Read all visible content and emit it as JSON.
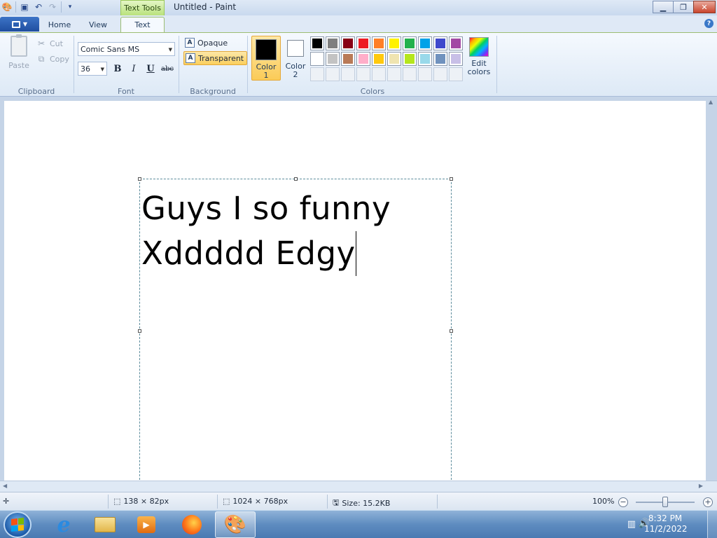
{
  "window": {
    "title": "Untitled - Paint",
    "context_tab": "Text Tools"
  },
  "tabs": [
    "Home",
    "View",
    "Text"
  ],
  "active_tab": "Text",
  "clipboard": {
    "paste": "Paste",
    "cut": "Cut",
    "copy": "Copy",
    "label": "Clipboard"
  },
  "font": {
    "family": "Comic Sans MS",
    "size": "36",
    "bold": "B",
    "italic": "I",
    "underline": "U",
    "strikethrough": "abc",
    "label": "Font"
  },
  "background": {
    "opaque": "Opaque",
    "transparent": "Transparent",
    "selected": "Transparent",
    "label": "Background"
  },
  "colors": {
    "color1_label_line1": "Color",
    "color1_label_line2": "1",
    "color1_value": "#000000",
    "color2_label_line1": "Color",
    "color2_label_line2": "2",
    "color2_value": "#ffffff",
    "edit_line1": "Edit",
    "edit_line2": "colors",
    "label": "Colors",
    "palette_row1": [
      "#000000",
      "#7f7f7f",
      "#880015",
      "#ed1c24",
      "#ff7f27",
      "#fff200",
      "#22b14c",
      "#00a2e8",
      "#3f48cc",
      "#a349a4"
    ],
    "palette_row2": [
      "#ffffff",
      "#c3c3c3",
      "#b97a57",
      "#ffaec9",
      "#ffc90e",
      "#efe4b0",
      "#b5e61d",
      "#99d9ea",
      "#7092be",
      "#c8bfe7"
    ]
  },
  "canvas": {
    "line1": "Guys I so funny",
    "line2": "Xddddd Edgy"
  },
  "status": {
    "selection_size": "138 × 82px",
    "canvas_size": "1024 × 768px",
    "file_size": "Size: 15.2KB",
    "zoom": "100%"
  },
  "taskbar": {
    "time": "8:32 PM",
    "date": "11/2/2022"
  }
}
